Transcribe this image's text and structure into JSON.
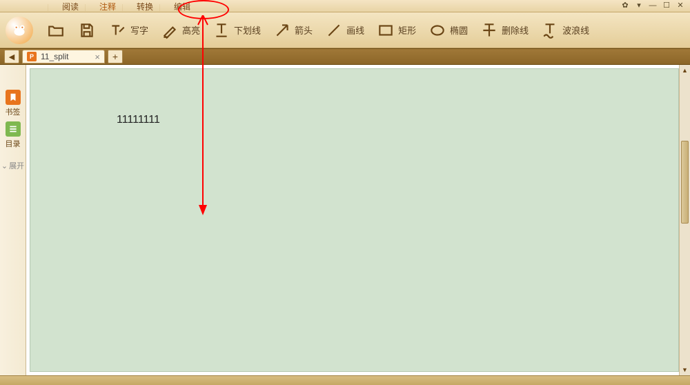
{
  "menu_tabs": {
    "read": "阅读",
    "annotate": "注释",
    "convert": "转换",
    "edit": "编辑"
  },
  "tools": {
    "text": "写字",
    "highlight": "高亮",
    "underline": "下划线",
    "arrow": "箭头",
    "line": "画线",
    "rect": "矩形",
    "ellipse": "椭圆",
    "strikeout": "删除线",
    "wave": "波浪线"
  },
  "doc_tab": {
    "name": "11_split",
    "badge": "P"
  },
  "sidebar": {
    "bookmark": "书签",
    "toc": "目录",
    "expand": "展开"
  },
  "canvas": {
    "sample_text": "11111111"
  }
}
